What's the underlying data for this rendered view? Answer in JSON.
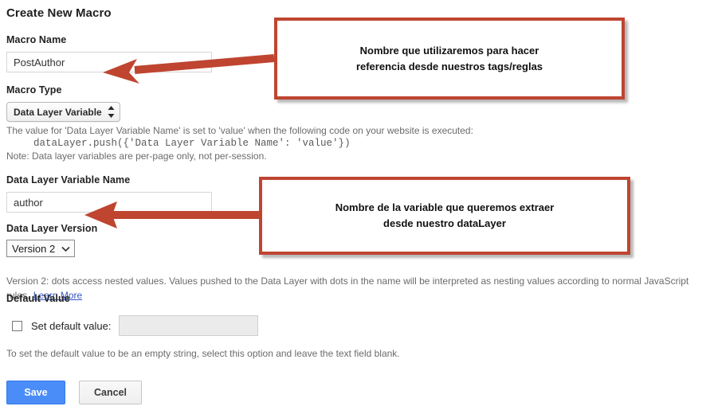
{
  "page": {
    "title": "Create New Macro"
  },
  "fields": {
    "macro_name": {
      "label": "Macro Name",
      "value": "PostAuthor",
      "placeholder": ""
    },
    "macro_type": {
      "label": "Macro Type",
      "selected": "Data Layer Variable",
      "options": [
        "Data Layer Variable"
      ],
      "icon": "up-down-arrows-icon"
    },
    "data_layer_variable_name": {
      "label": "Data Layer Variable Name",
      "value": "author",
      "placeholder": ""
    },
    "data_layer_version": {
      "label": "Data Layer Version",
      "selected": "Version 2",
      "options": [
        "Version 2"
      ],
      "icon": "chevron-down-icon"
    },
    "default_value": {
      "label": "Default Value",
      "checkbox_label": "Set default value:",
      "checked": false,
      "value": "",
      "placeholder": ""
    }
  },
  "help": {
    "macro_type_line1": "The value for 'Data Layer Variable Name' is set to 'value' when the following code on your website is executed:",
    "macro_type_code": "dataLayer.push({'Data Layer Variable Name': 'value'})",
    "macro_type_note": "Note: Data layer variables are per-page only, not per-session.",
    "version_text": "Version 2: dots access nested values. Values pushed to the Data Layer with dots in the name will be interpreted as nesting values according to normal JavaScript rules.",
    "learn_more": "Learn More",
    "default_value_text": "To set the default value to be an empty string, select this option and leave the text field blank."
  },
  "buttons": {
    "save": "Save",
    "cancel": "Cancel"
  },
  "annotations": [
    {
      "id": "macro-name-callout",
      "line1": "Nombre que utilizaremos para hacer",
      "line2": "referencia desde nuestros tags/reglas"
    },
    {
      "id": "data-layer-variable-callout",
      "line1": "Nombre de la variable que queremos extraer",
      "line2": "desde nuestro dataLayer"
    }
  ],
  "colors": {
    "annotation_red": "#BF4530",
    "primary_button": "#4b8df8",
    "link_blue": "#3657c0"
  }
}
